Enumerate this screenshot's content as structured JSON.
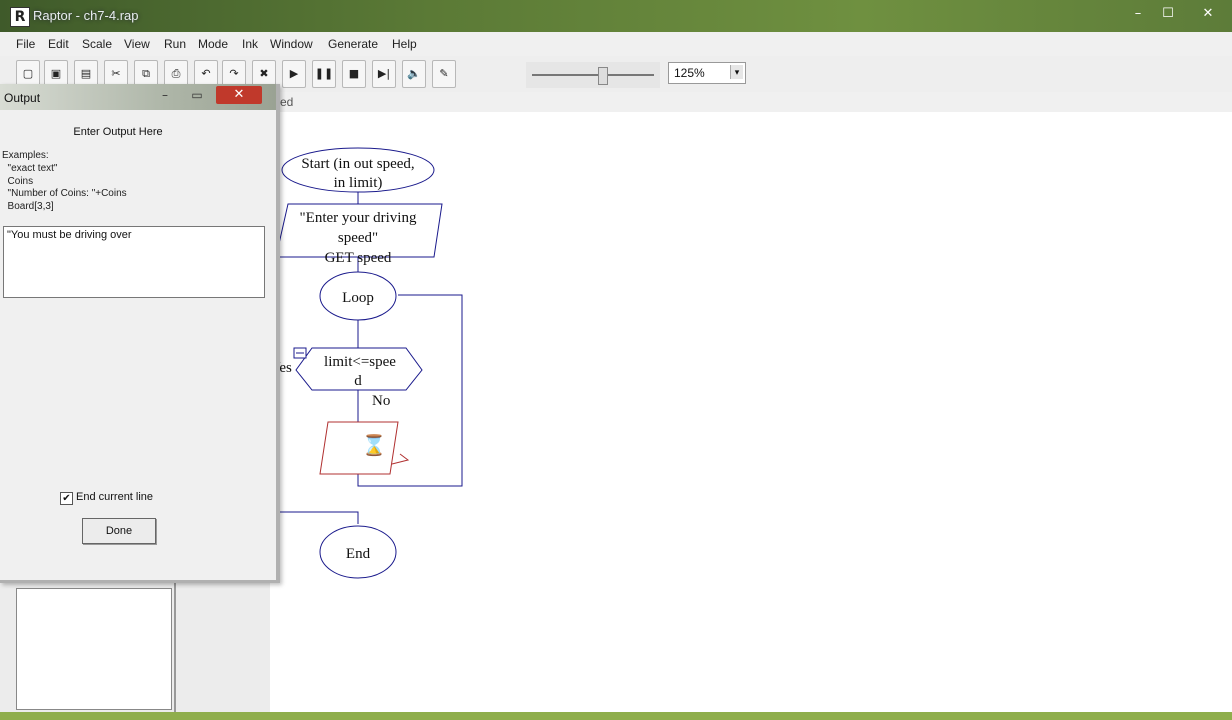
{
  "window": {
    "title": "Raptor - ch7-4.rap",
    "minimize_label": "–",
    "maximize_label": "☐",
    "close_label": "✕"
  },
  "menu": [
    "File",
    "Edit",
    "Scale",
    "View",
    "Run",
    "Mode",
    "Ink",
    "Window",
    "Generate",
    "Help"
  ],
  "toolbar": {
    "buttons": [
      "new-icon",
      "open-icon",
      "save-icon",
      "cut-icon",
      "copy-icon",
      "print-icon",
      "undo-icon",
      "redo-icon",
      "delete-icon",
      "play-icon",
      "pause-icon",
      "stop-icon",
      "step-icon",
      "speaker-icon",
      "pen-icon"
    ],
    "glyphs": [
      "▢",
      "▣",
      "▤",
      "✂",
      "⧉",
      "⎙",
      "↶",
      "↷",
      "✖",
      "▶",
      "❚❚",
      "■",
      "▶|",
      "🔈",
      "✎"
    ],
    "speed_level": 0.58,
    "zoom": "125%",
    "zoom_arrow": "▾"
  },
  "canvas": {
    "tab_label": "ed"
  },
  "flowchart": {
    "start": [
      "Start (in out speed,",
      "in limit)"
    ],
    "output": [
      "\"Enter your driving",
      "speed\""
    ],
    "input": "GET speed",
    "loop": "Loop",
    "decision": [
      "limit<=spee",
      "d"
    ],
    "yes_label": "Yes",
    "no_label": "No",
    "placeholder_glyph": "⌛",
    "end": "End"
  },
  "dialog": {
    "title": "Output",
    "minimize_label": "–",
    "maximize_label": "▭",
    "close_label": "✕",
    "heading": "Enter Output Here",
    "examples": [
      "Examples:",
      "  \"exact text\"",
      "  Coins",
      "  \"Number of Coins: \"+Coins",
      "  Board[3,3]"
    ],
    "input_value": "\"You must be driving over",
    "end_line_label": "End current line",
    "end_line_checked": true,
    "check_glyph": "✔",
    "done_label": "Done"
  }
}
